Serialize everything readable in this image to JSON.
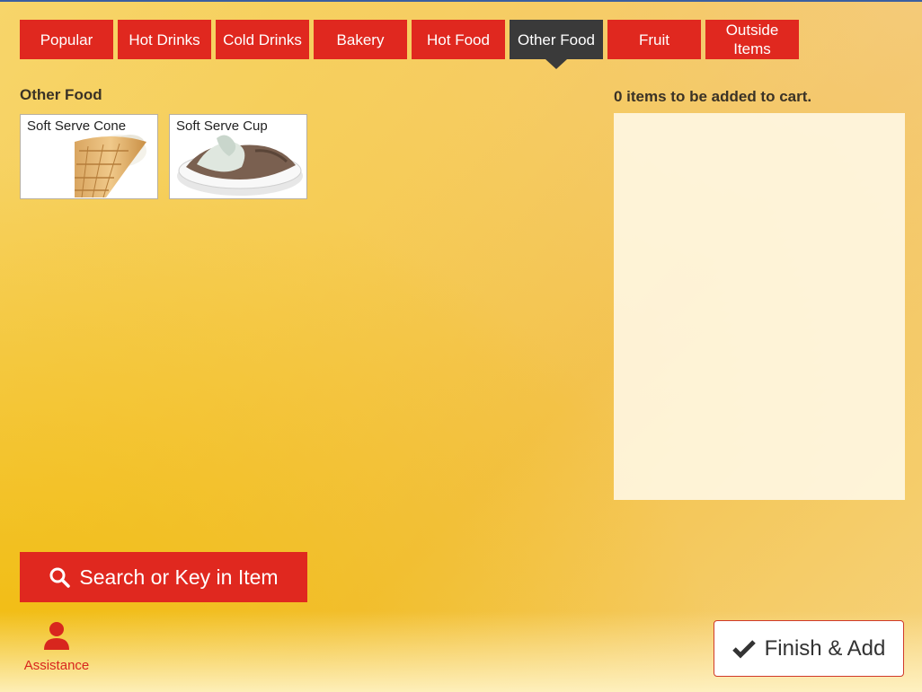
{
  "tabs": [
    {
      "label": "Popular"
    },
    {
      "label": "Hot Drinks"
    },
    {
      "label": "Cold Drinks"
    },
    {
      "label": "Bakery"
    },
    {
      "label": "Hot Food"
    },
    {
      "label": "Other Food",
      "active": true
    },
    {
      "label": "Fruit"
    },
    {
      "label": "Outside Items"
    }
  ],
  "section": {
    "title": "Other Food"
  },
  "items": [
    {
      "label": "Soft Serve Cone",
      "icon": "ice-cream-cone-image"
    },
    {
      "label": "Soft Serve Cup",
      "icon": "ice-cream-cup-image"
    }
  ],
  "cart": {
    "status": "0 items to be added to cart."
  },
  "search": {
    "label": "Search or Key in Item",
    "icon": "search-icon"
  },
  "assistance": {
    "label": "Assistance",
    "icon": "person-icon"
  },
  "finish": {
    "label": "Finish & Add",
    "icon": "checkmark-icon"
  },
  "colors": {
    "accent": "#e0281f",
    "active_tab": "#3a3a3a"
  }
}
